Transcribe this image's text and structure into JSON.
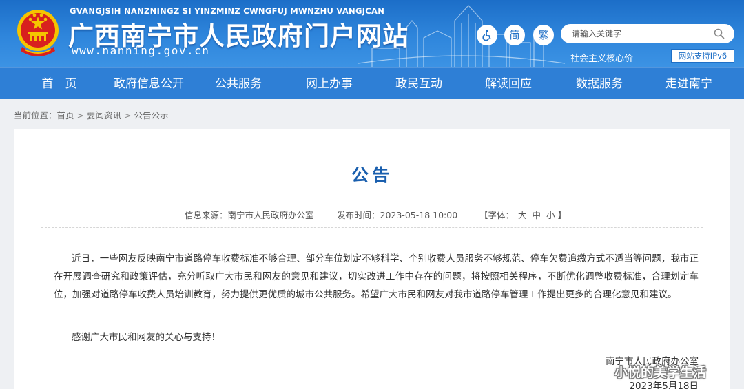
{
  "header": {
    "pinyin": "GVANGJSIH NANZNINGZ SI YINZMINZ CWNGFUJ MWNZHU VANGJCAN",
    "title": "广西南宁市人民政府门户网站",
    "url": "www.nanning.gov.cn",
    "accessibility_icon": "wheelchair-icon",
    "simplified_label": "简",
    "traditional_label": "繁",
    "search_placeholder": "请输入关键字",
    "core_values": "社会主义核心价",
    "ipv6_badge": "网站支持IPv6",
    "colors": {
      "primary": "#2e7fd6",
      "title_blue": "#1a5fae"
    }
  },
  "nav": {
    "items": [
      "首　页",
      "政府信息公开",
      "公共服务",
      "网上办事",
      "政民互动",
      "解读回应",
      "数据服务",
      "走进南宁"
    ]
  },
  "breadcrumb": {
    "prefix": "当前位置：",
    "items": [
      "首页",
      "要闻资讯",
      "公告公示"
    ],
    "separator": ">"
  },
  "article": {
    "title": "公告",
    "source_label": "信息来源：",
    "source": "南宁市人民政府办公室",
    "time_label": "发布时间：",
    "time": "2023-05-18 10:00",
    "font_label": "【字体：",
    "font_sizes": [
      "大",
      "中",
      "小"
    ],
    "font_close": "】",
    "paragraphs": [
      "近日，一些网友反映南宁市道路停车收费标准不够合理、部分车位划定不够科学、个别收费人员服务不够规范、停车欠费追缴方式不适当等问题，我市正在开展调查研究和政策评估，充分听取广大市民和网友的意见和建议，切实改进工作中存在的问题，将按照相关程序，不断优化调整收费标准，合理划定车位，加强对道路停车收费人员培训教育，努力提供更优质的城市公共服务。希望广大市民和网友对我市道路停车管理工作提出更多的合理化意见和建议。",
      "感谢广大市民和网友的关心与支持！"
    ],
    "signature": "南宁市人民政府办公室",
    "date": "2023年5月18日"
  },
  "watermark": "小悦的美学生活"
}
